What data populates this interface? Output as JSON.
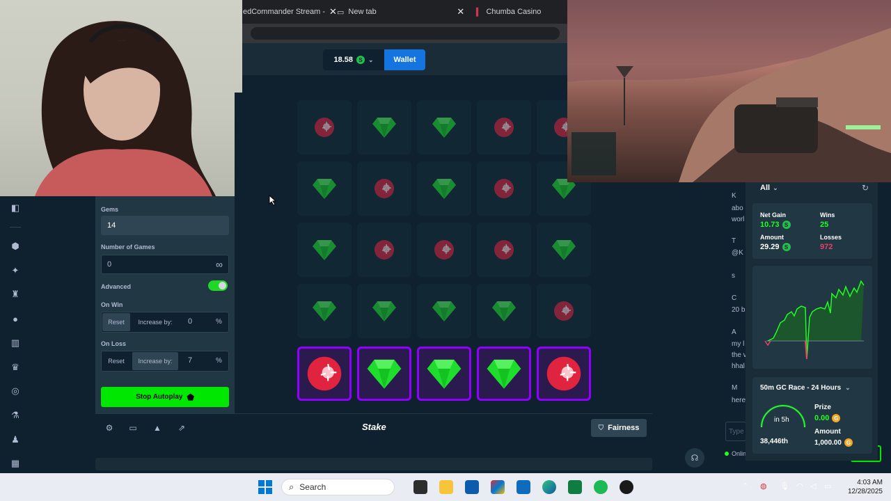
{
  "browser": {
    "tabs": [
      {
        "label": "edCommander Stream -"
      },
      {
        "label": "New tab"
      },
      {
        "label": "Chumba Casino"
      }
    ]
  },
  "header": {
    "balance": "18.58",
    "currency_symbol": "S",
    "wallet_label": "Wallet"
  },
  "controls": {
    "gems_label": "Gems",
    "gems_value": "14",
    "num_games_label": "Number of Games",
    "num_games_value": "0",
    "infinity_symbol": "∞",
    "advanced_label": "Advanced",
    "advanced_on": true,
    "on_win_label": "On Win",
    "on_win_reset": "Reset",
    "on_win_increase": "Increase by:",
    "on_win_value": "0",
    "on_loss_label": "On Loss",
    "on_loss_reset": "Reset",
    "on_loss_increase": "Increase by:",
    "on_loss_value": "7",
    "percent": "%",
    "stop_button": "Stop Autoplay"
  },
  "grid": {
    "rows": [
      [
        "mine",
        "gem",
        "gem",
        "mine",
        "mine"
      ],
      [
        "gem",
        "mine",
        "gem",
        "mine",
        "gem"
      ],
      [
        "gem",
        "mine",
        "mine",
        "mine",
        "gem"
      ],
      [
        "gem",
        "gem",
        "gem",
        "gem",
        "mine"
      ],
      [
        "mine",
        "gem",
        "gem",
        "gem",
        "mine"
      ]
    ],
    "selected_row": 4
  },
  "footer": {
    "logo": "Stake",
    "fairness_label": "Fairness"
  },
  "stats": {
    "filter": "All",
    "net_gain_label": "Net Gain",
    "net_gain_value": "10.73",
    "wins_label": "Wins",
    "wins_value": "25",
    "amount_label": "Amount",
    "amount_value": "29.29",
    "losses_label": "Losses",
    "losses_value": "972",
    "race_title": "50m GC Race - 24 Hours",
    "race_timer": "in 5h",
    "race_rank": "38,446th",
    "prize_label": "Prize",
    "prize_value": "0.00",
    "race_amount_label": "Amount",
    "race_amount_value": "1,000.00",
    "gold_symbol": "G"
  },
  "chat": {
    "lines": [
      "K",
      "abo",
      "worl",
      "T",
      "@K",
      "s",
      "C",
      "20 b",
      "A",
      "my l",
      "the v",
      "hhal",
      "M",
      "here"
    ],
    "input_placeholder": "Type",
    "online_label": "Onlin"
  },
  "taskbar": {
    "search_placeholder": "Search",
    "time": "4:03 AM",
    "date": "12/28/2025"
  },
  "colors": {
    "gem": "#1fdd2d",
    "mine": "#e0243f",
    "selected_border": "#9000ff",
    "accent_green": "#00e701",
    "wallet_blue": "#1475e1"
  }
}
